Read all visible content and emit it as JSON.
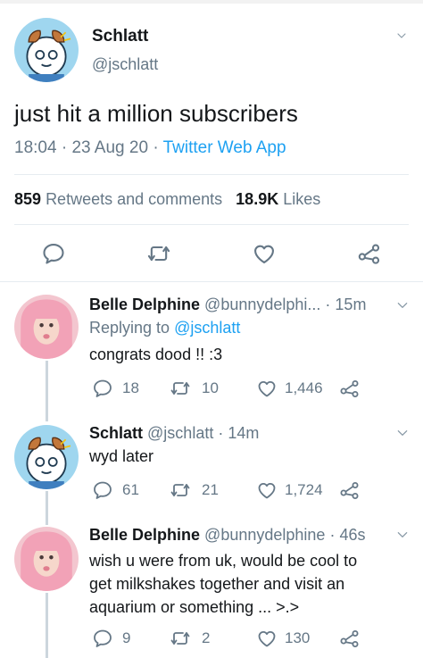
{
  "main_tweet": {
    "author_name": "Schlatt",
    "author_handle": "@jschlatt",
    "text": "just hit a million subscribers",
    "time": "18:04",
    "date": "23 Aug 20",
    "source": "Twitter Web App",
    "dot1": "·",
    "dot2": "·",
    "retweets_count": "859",
    "retweets_label": "Retweets and comments",
    "likes_count": "18.9K",
    "likes_label": "Likes"
  },
  "replies": [
    {
      "name": "Belle Delphine",
      "handle": "@bunnydelphi...",
      "time": "· 15m",
      "replying_prefix": "Replying to",
      "replying_handle": "@jschlatt",
      "text": "congrats dood !! :3",
      "reply_count": "18",
      "retweet_count": "10",
      "like_count": "1,446"
    },
    {
      "name": "Schlatt",
      "handle": "@jschlatt",
      "time": "· 14m",
      "text": "wyd later",
      "reply_count": "61",
      "retweet_count": "21",
      "like_count": "1,724"
    },
    {
      "name": "Belle Delphine",
      "handle": "@bunnydelphine",
      "time": "· 46s",
      "text_lines": [
        "wish u were from uk, would be cool to",
        "get milkshakes together and visit an",
        "aquarium or something ... >.>"
      ],
      "reply_count": "9",
      "retweet_count": "2",
      "like_count": "130"
    }
  ],
  "colors": {
    "accent": "#1da1f2",
    "muted": "#657786",
    "text": "#14171a",
    "divider": "#e6ecf0"
  }
}
